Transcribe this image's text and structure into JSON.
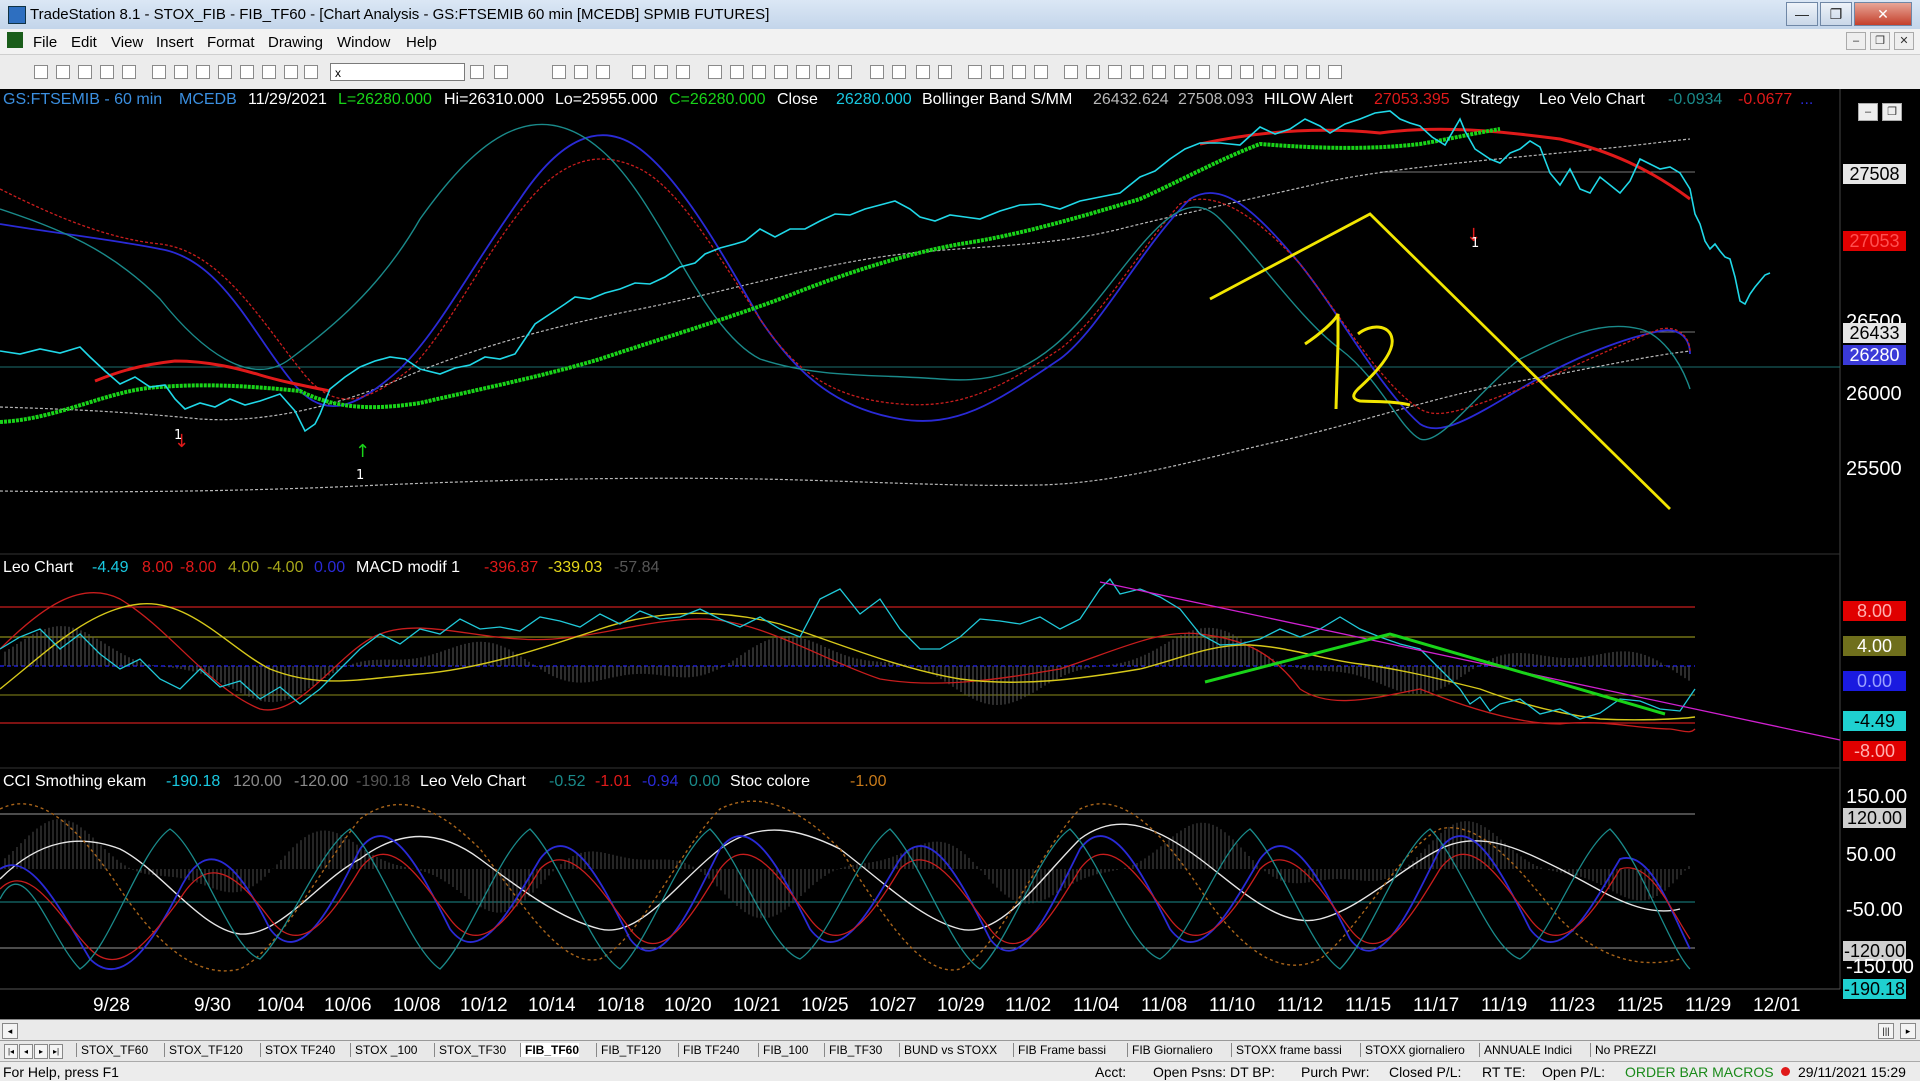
{
  "window": {
    "title": "TradeStation 8.1 - STOX_FIB - FIB_TF60 - [Chart Analysis - GS:FTSEMIB  60 min  [MCEDB] SPMIB FUTURES]",
    "minimize": "—",
    "maximize": "❐",
    "close": "✕"
  },
  "menu": [
    "File",
    "Edit",
    "View",
    "Insert",
    "Format",
    "Drawing",
    "Window",
    "Help"
  ],
  "mdi": {
    "minimize": "–",
    "restore": "❐",
    "close": "✕"
  },
  "toolbar": {
    "symbol_box": "x"
  },
  "panel1": {
    "symbol": "GS:FTSEMIB - 60 min",
    "exchange": "MCEDB",
    "date": "11/29/2021",
    "last": "L=26280.000",
    "hi": "Hi=26310.000",
    "lo": "Lo=25955.000",
    "close_eq": "C=26280.000",
    "close_label": "Close",
    "close_value": "26280.000",
    "bb_label": "Bollinger Band S/MM",
    "bb_v1": "26432.624",
    "bb_v2": "27508.093",
    "hilow_label": "HILOW Alert",
    "hilow_value": "27053.395",
    "strategy": "Strategy",
    "leo_velo": "Leo Velo Chart",
    "lv1": "-0.0934",
    "lv2": "-0.0677",
    "lv3": "...",
    "annotation": "12",
    "marker_1": "1",
    "boxes": [
      {
        "text": "27508",
        "bg": "#e6e6e6",
        "fg": "#000000"
      },
      {
        "text": "27053",
        "bg": "#e00000",
        "fg": "#ff5050"
      },
      {
        "text": "26433",
        "bg": "#e6e6e6",
        "fg": "#000000"
      },
      {
        "text": "26280",
        "bg": "#3a3ad8",
        "fg": "#ffffff"
      }
    ],
    "scale": [
      "26500",
      "26000",
      "25500"
    ]
  },
  "panel2": {
    "name": "Leo Chart",
    "v1": "-4.49",
    "v2": "8.00",
    "v3": "-8.00",
    "v4": "4.00",
    "v5": "-4.00",
    "v6": "0.00",
    "macd_label": "MACD modif 1",
    "m1": "-396.87",
    "m2": "-339.03",
    "m3": "-57.84",
    "boxes": [
      {
        "text": "8.00",
        "bg": "#e00000",
        "fg": "#ffb0b0"
      },
      {
        "text": "4.00",
        "bg": "#6f6f1c",
        "fg": "#ffffff"
      },
      {
        "text": "0.00",
        "bg": "#1a1ae0",
        "fg": "#9aa0ff"
      },
      {
        "text": "-4.49",
        "bg": "#1fd0d0",
        "fg": "#000000"
      },
      {
        "text": "-8.00",
        "bg": "#e00000",
        "fg": "#ffb0b0"
      }
    ]
  },
  "panel3": {
    "name": "CCI Smothing ekam",
    "c1": "-190.18",
    "c2": "120.00",
    "c3": "-120.00",
    "c4": "-190.18",
    "leo_velo": "Leo Velo Chart",
    "lv1": "-0.52",
    "lv2": "-1.01",
    "lv3": "-0.94",
    "lv4": "0.00",
    "stoc_label": "Stoc colore",
    "stoc_value": "-1.00",
    "scale": [
      "150.00",
      "50.00",
      "-50.00",
      "-150.00"
    ],
    "boxes": [
      {
        "text": "120.00",
        "bg": "#cfcfcf",
        "fg": "#000000"
      },
      {
        "text": "-120.00",
        "bg": "#cfcfcf",
        "fg": "#000000"
      },
      {
        "text": "-190.18",
        "bg": "#1fd0d0",
        "fg": "#000000"
      }
    ]
  },
  "xaxis": [
    "9/28",
    "9/30",
    "10/04",
    "10/06",
    "10/08",
    "10/12",
    "10/14",
    "10/18",
    "10/20",
    "10/21",
    "10/25",
    "10/27",
    "10/29",
    "11/02",
    "11/04",
    "11/08",
    "11/10",
    "11/12",
    "11/15",
    "11/17",
    "11/19",
    "11/23",
    "11/25",
    "11/29",
    "12/01"
  ],
  "tabs": [
    "STOX_TF60",
    "STOX_TF120",
    "STOX TF240",
    "STOX _100",
    "STOX_TF30",
    "FIB_TF60",
    "FIB_TF120",
    "FIB TF240",
    "FIB_100",
    "FIB_TF30",
    "BUND vs STOXX",
    "FIB Frame bassi",
    "FIB Giornaliero",
    "STOXX frame bassi",
    "STOXX giornaliero",
    "ANNUALE Indici",
    "No PREZZI"
  ],
  "status": {
    "help": "For Help, press F1",
    "acct": "Acct:",
    "open_psns": "Open Psns:",
    "dt_bp": "DT BP:",
    "purch_pwr": "Purch Pwr:",
    "closed_pl": "Closed P/L:",
    "rt_te": "RT TE:",
    "open_pl": "Open P/L:",
    "order_bar": "ORDER BAR  MACROS",
    "datetime": "29/11/2021 15:29"
  }
}
